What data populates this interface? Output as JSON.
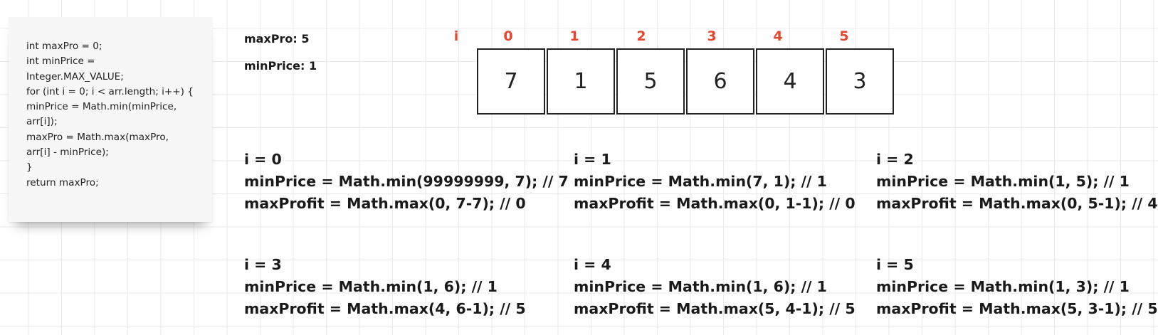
{
  "code_note": {
    "lines": [
      "int maxPro = 0;",
      "int minPrice =",
      "Integer.MAX_VALUE;",
      "for (int i = 0; i < arr.length; i++) {",
      "minPrice = Math.min(minPrice,",
      "arr[i]);",
      "maxPro = Math.max(maxPro,",
      "arr[i] - minPrice);",
      "}",
      "return maxPro;"
    ]
  },
  "state": {
    "max_pro": "maxPro: 5",
    "min_price": "minPrice: 1"
  },
  "array": {
    "index_label": "i",
    "indices": [
      "0",
      "1",
      "2",
      "3",
      "4",
      "5"
    ],
    "values": [
      "7",
      "1",
      "5",
      "6",
      "4",
      "3"
    ],
    "index_color": "#e8452c"
  },
  "steps": [
    {
      "i": "i = 0",
      "min": "minPrice = Math.min(99999999, 7); // 7",
      "max": "maxProfit = Math.max(0, 7-7);  // 0"
    },
    {
      "i": "i = 1",
      "min": "minPrice = Math.min(7, 1); // 1",
      "max": "maxProfit = Math.max(0, 1-1);  // 0"
    },
    {
      "i": "i = 2",
      "min": "minPrice = Math.min(1, 5); // 1",
      "max": "maxProfit = Math.max(0, 5-1);  // 4"
    },
    {
      "i": "i = 3",
      "min": "minPrice = Math.min(1, 6); // 1",
      "max": "maxProfit = Math.max(4, 6-1);  // 5"
    },
    {
      "i": "i = 4",
      "min": "minPrice = Math.min(1, 6); // 1",
      "max": "maxProfit = Math.max(5, 4-1);  // 5"
    },
    {
      "i": "i = 5",
      "min": "minPrice = Math.min(1, 3); // 1",
      "max": "maxProfit = Math.max(5, 3-1);  // 5"
    }
  ]
}
